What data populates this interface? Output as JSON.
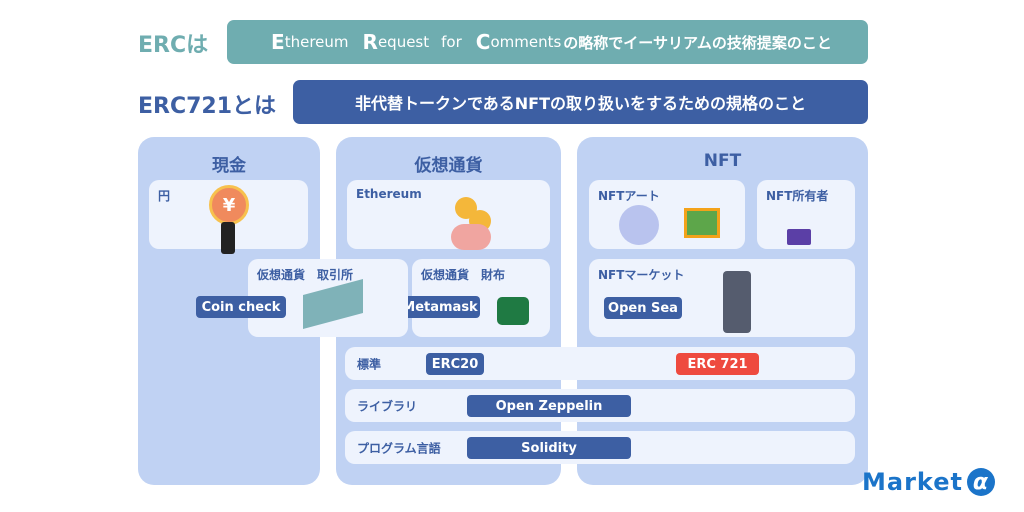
{
  "header": {
    "erc_heading": "ERCは",
    "erc_definition": {
      "e_cap": "E",
      "e_rest": "thereum",
      "r_cap": "R",
      "r_rest": "equest",
      "for": "for",
      "c_cap": "C",
      "c_rest": "omments",
      "suffix": "の略称でイーサリアムの技術提案のこと"
    },
    "erc721_heading": "ERC721とは",
    "erc721_definition": "非代替トークンであるNFTの取り扱いをするための規格のこと"
  },
  "columns": {
    "cash": {
      "title": "現金",
      "card_label": "円"
    },
    "crypto": {
      "title": "仮想通貨",
      "ethereum_label": "Ethereum",
      "exchange_label": "仮想通貨　取引所",
      "exchange_pill": "Coin check",
      "wallet_label": "仮想通貨　財布",
      "wallet_pill": "Metamask"
    },
    "nft": {
      "title": "NFT",
      "art_label": "NFTアート",
      "owner_label": "NFT所有者",
      "market_label": "NFTマーケット",
      "market_pill": "Open Sea"
    }
  },
  "rows": {
    "standard": {
      "label": "標準",
      "ft_pill": "ERC20",
      "nft_pill": "ERC 721"
    },
    "library": {
      "label": "ライブラリ",
      "pill": "Open Zeppelin"
    },
    "language": {
      "label": "プログラム言語",
      "pill": "Solidity"
    }
  },
  "colors": {
    "teal": "#6fadb0",
    "navy": "#3d5fa3",
    "red": "#ee4a3f",
    "column_bg": "#c0d2f3",
    "card_bg": "#eef3fd",
    "logo_blue": "#1b74c9"
  },
  "logo": {
    "text": "Market",
    "mark": "α"
  }
}
